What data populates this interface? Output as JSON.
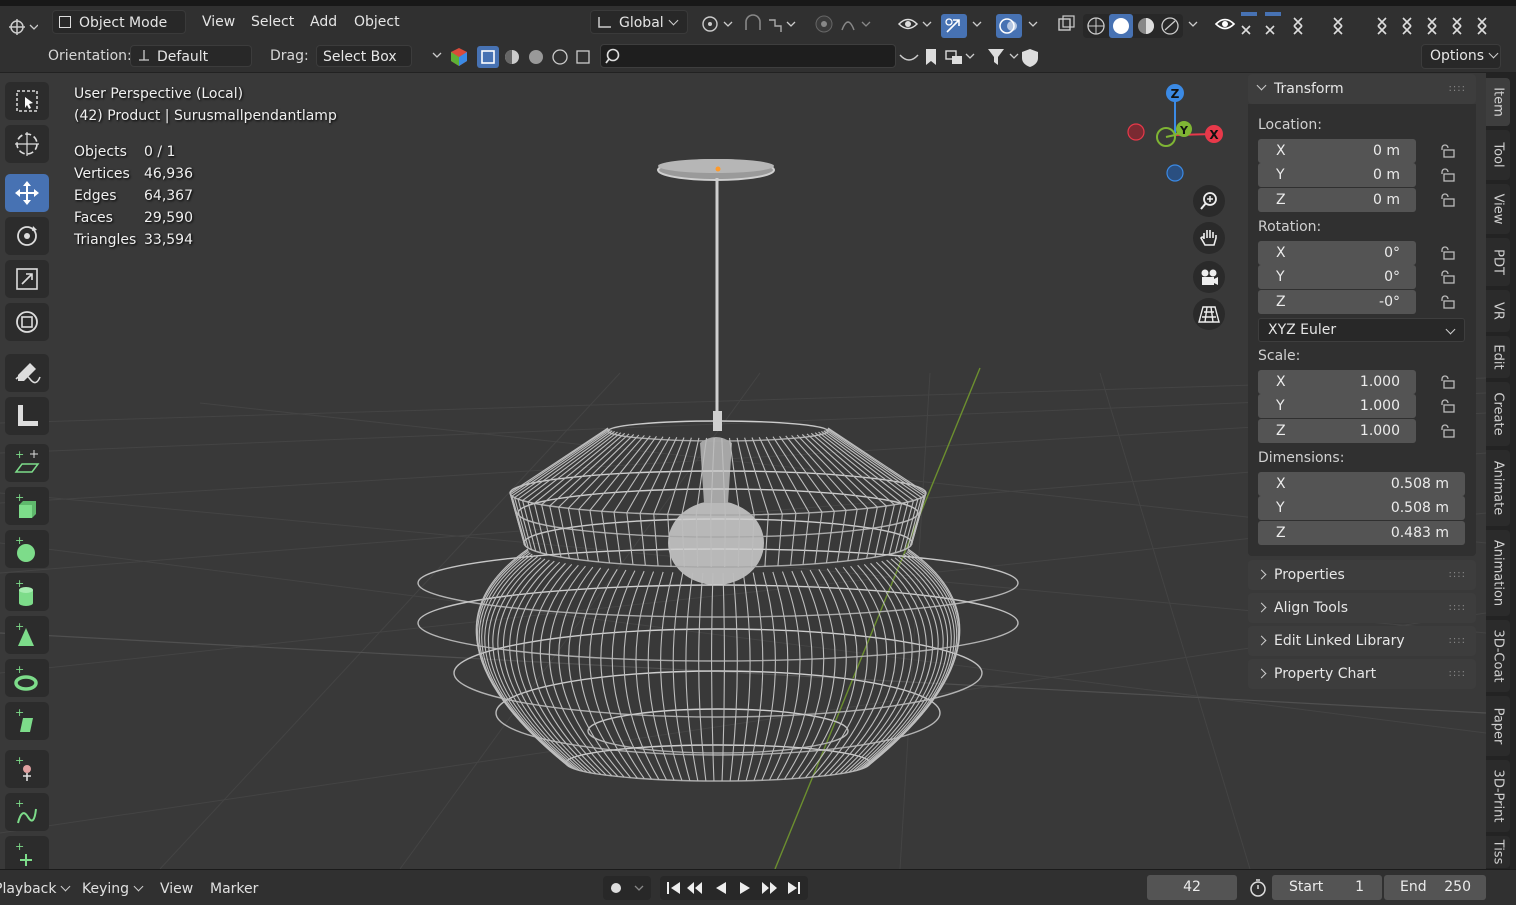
{
  "header": {
    "mode": "Object Mode",
    "menus": [
      "View",
      "Select",
      "Add",
      "Object"
    ],
    "transform_orientation": "Global"
  },
  "toolbar": {
    "orientation_label": "Orientation:",
    "orientation_value": "Default",
    "drag_label": "Drag:",
    "drag_value": "Select Box",
    "options_label": "Options"
  },
  "viewport": {
    "perspective": "User Perspective (Local)",
    "object_info": "(42) Product | Surusmallpendantlamp",
    "stats": [
      {
        "label": "Objects",
        "value": "0 / 1"
      },
      {
        "label": "Vertices",
        "value": "46,936"
      },
      {
        "label": "Edges",
        "value": "64,367"
      },
      {
        "label": "Faces",
        "value": "29,590"
      },
      {
        "label": "Triangles",
        "value": "33,594"
      }
    ],
    "gizmo_axes": {
      "z": "Z",
      "y": "Y",
      "x": "X"
    }
  },
  "npanel": {
    "transform_title": "Transform",
    "location_label": "Location:",
    "location": [
      {
        "axis": "X",
        "value": "0 m"
      },
      {
        "axis": "Y",
        "value": "0 m"
      },
      {
        "axis": "Z",
        "value": "0 m"
      }
    ],
    "rotation_label": "Rotation:",
    "rotation": [
      {
        "axis": "X",
        "value": "0°"
      },
      {
        "axis": "Y",
        "value": "0°"
      },
      {
        "axis": "Z",
        "value": "-0°"
      }
    ],
    "rotation_mode": "XYZ Euler",
    "scale_label": "Scale:",
    "scale": [
      {
        "axis": "X",
        "value": "1.000"
      },
      {
        "axis": "Y",
        "value": "1.000"
      },
      {
        "axis": "Z",
        "value": "1.000"
      }
    ],
    "dimensions_label": "Dimensions:",
    "dimensions": [
      {
        "axis": "X",
        "value": "0.508 m"
      },
      {
        "axis": "Y",
        "value": "0.508 m"
      },
      {
        "axis": "Z",
        "value": "0.483 m"
      }
    ],
    "collapsed_panels": [
      "Properties",
      "Align Tools",
      "Edit Linked Library",
      "Property Chart"
    ]
  },
  "tabs": [
    "Item",
    "Tool",
    "View",
    "PDT",
    "VR",
    "Edit",
    "Create",
    "Animate",
    "Animation",
    "3D-Coat",
    "Paper",
    "3D-Print",
    "Tiss"
  ],
  "timeline": {
    "playback": "Playback",
    "keying": "Keying",
    "view": "View",
    "marker": "Marker",
    "current_frame": "42",
    "start_label": "Start",
    "start_value": "1",
    "end_label": "End",
    "end_value": "250"
  },
  "colors": {
    "accent": "#4772b3",
    "axis_x": "#e8394a",
    "axis_y": "#7fb534",
    "axis_z": "#3b8ae5"
  }
}
